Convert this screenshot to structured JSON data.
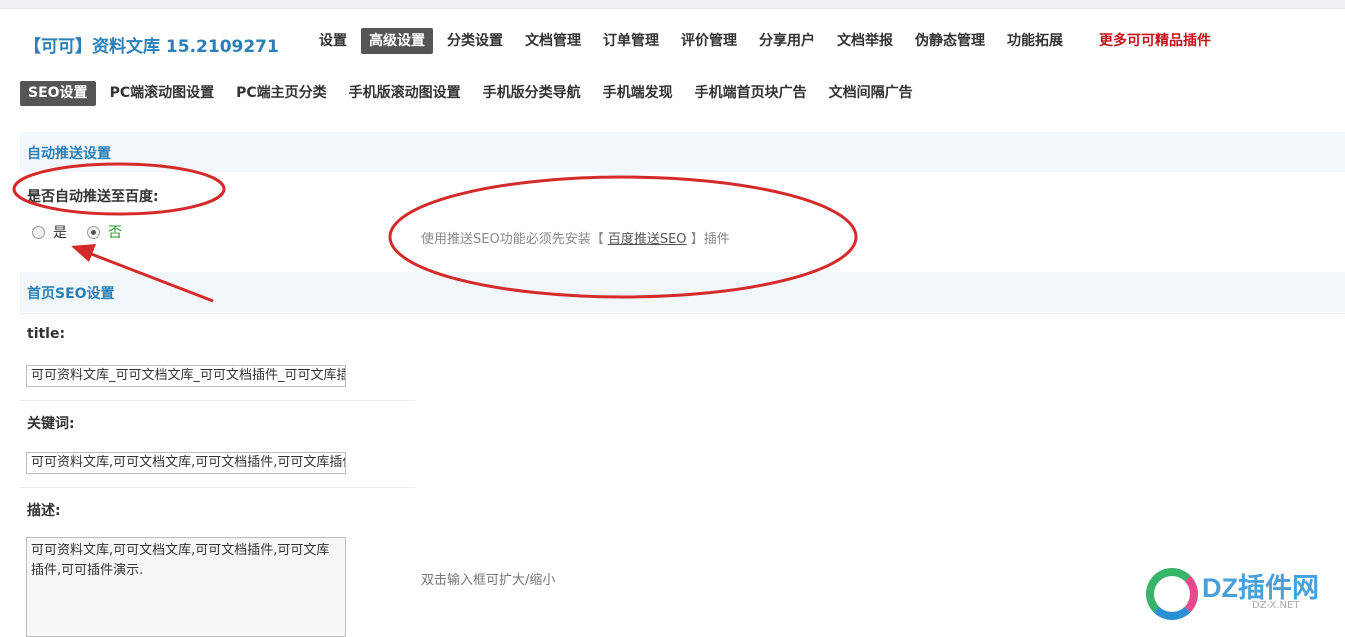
{
  "header": {
    "app_title": "【可可】资料文库 15.2109271",
    "nav": [
      {
        "label": "设置"
      },
      {
        "label": "高级设置"
      },
      {
        "label": "分类设置"
      },
      {
        "label": "文档管理"
      },
      {
        "label": "订单管理"
      },
      {
        "label": "评价管理"
      },
      {
        "label": "分享用户"
      },
      {
        "label": "文档举报"
      },
      {
        "label": "伪静态管理"
      },
      {
        "label": "功能拓展"
      }
    ],
    "promo_label": "更多可可精品插件",
    "active_nav": "高级设置"
  },
  "subnav": {
    "items": [
      {
        "label": "SEO设置"
      },
      {
        "label": "PC端滚动图设置"
      },
      {
        "label": "PC端主页分类"
      },
      {
        "label": "手机版滚动图设置"
      },
      {
        "label": "手机版分类导航"
      },
      {
        "label": "手机端发现"
      },
      {
        "label": "手机端首页块广告"
      },
      {
        "label": "文档间隔广告"
      }
    ],
    "active": "SEO设置"
  },
  "auto_push": {
    "section_title": "自动推送设置",
    "question": "是否自动推送至百度:",
    "options": {
      "yes": "是",
      "no": "否"
    },
    "selected": "否",
    "hint_prefix": "使用推送SEO功能必须先安装【",
    "hint_link": "百度推送SEO",
    "hint_suffix": "】插件"
  },
  "home_seo": {
    "section_title": "首页SEO设置",
    "title_label": "title:",
    "title_value": "可可资料文库_可可文档文库_可可文档插件_可可文库插件",
    "keywords_label": "关键词:",
    "keywords_value": "可可资料文库,可可文档文库,可可文档插件,可可文库插件",
    "description_label": "描述:",
    "description_value": "可可资料文库,可可文档文库,可可文档插件,可可文库插件,可可插件演示.",
    "description_hint": "双击输入框可扩大/缩小"
  },
  "annotation_color": "#d42a2a",
  "watermark": {
    "text": "DZ插件网",
    "sub": "DZ-X.NET"
  }
}
